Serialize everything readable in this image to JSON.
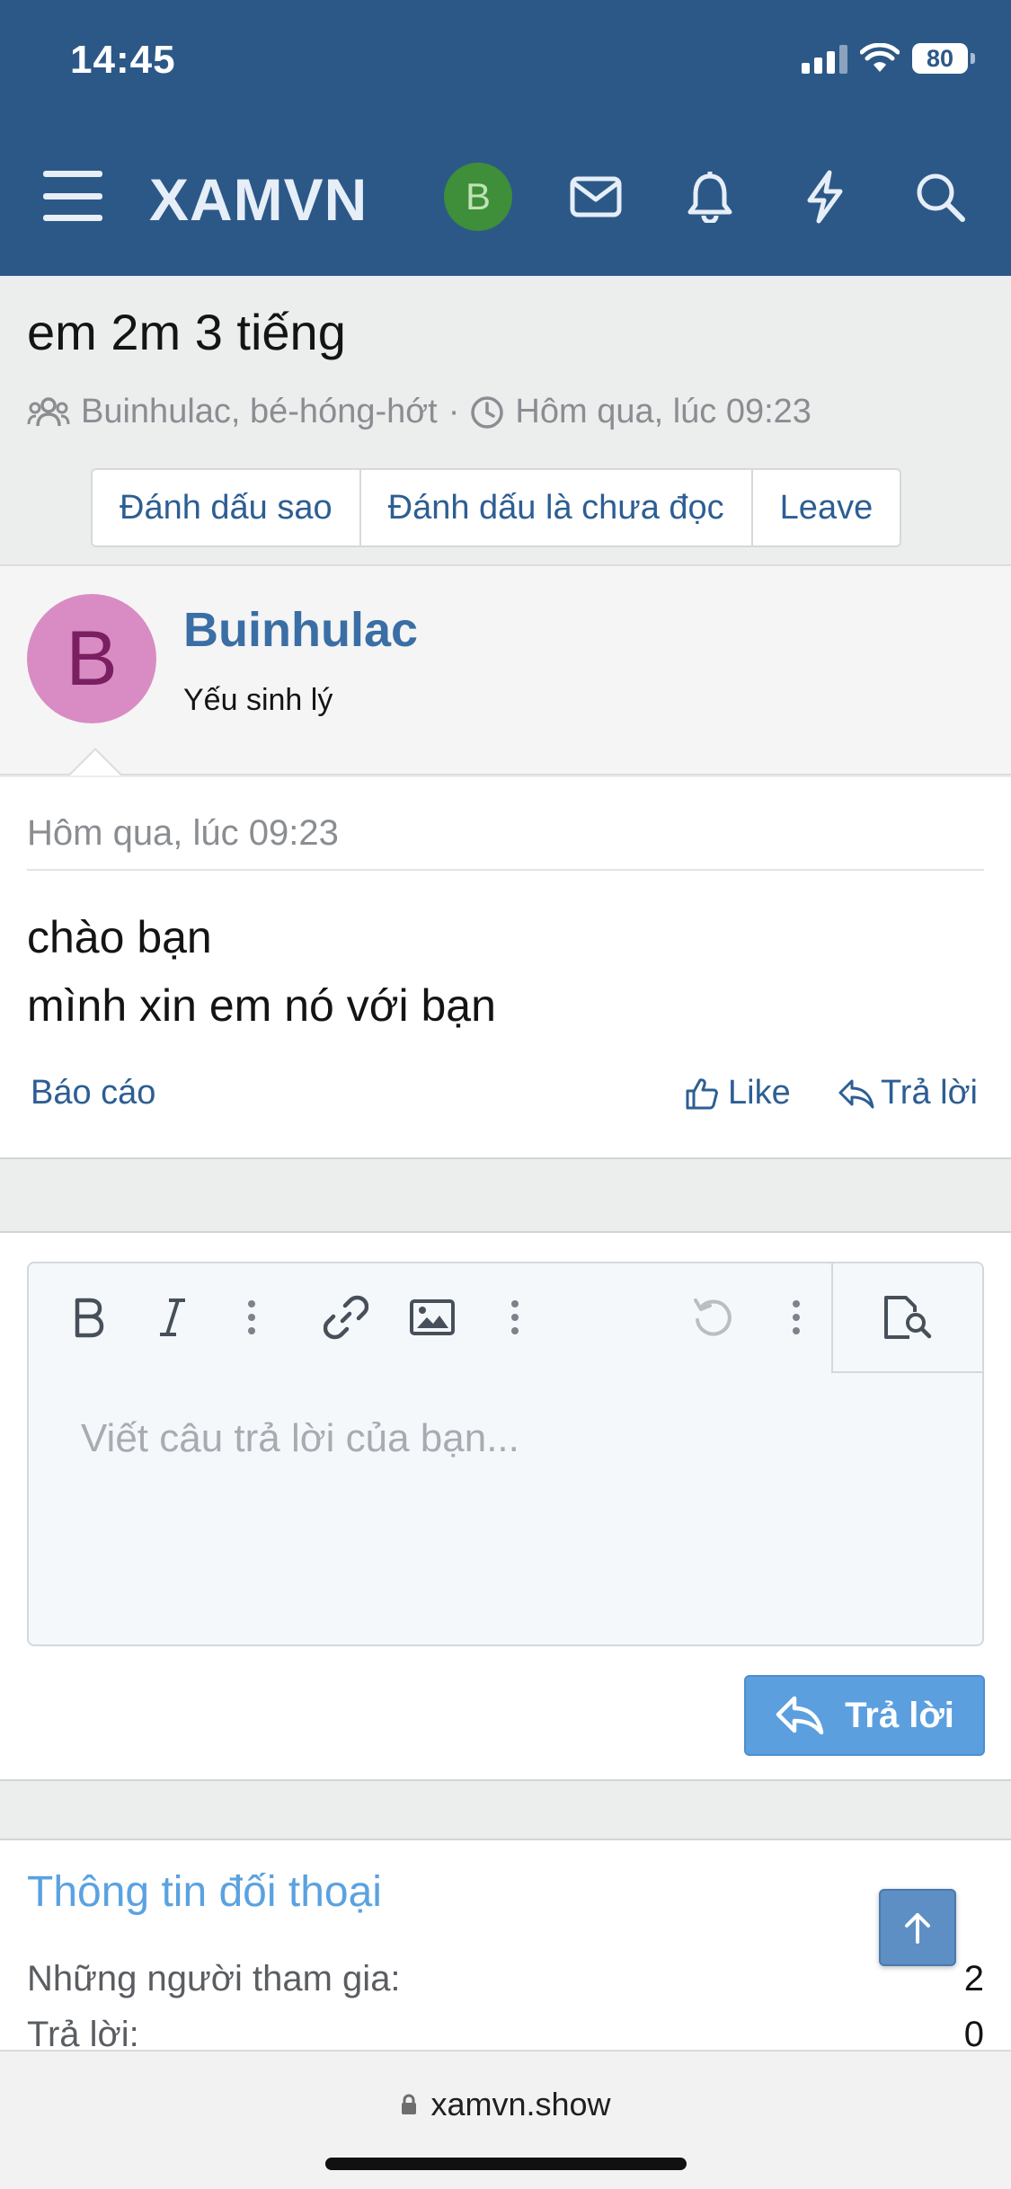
{
  "status_bar": {
    "time": "14:45",
    "battery": "80"
  },
  "header": {
    "brand": "XAMVN",
    "avatar_letter": "B"
  },
  "conversation": {
    "title": "em 2m 3 tiếng",
    "participants": "Buinhulac, bé-hóng-hớt",
    "separator": "·",
    "time": "Hôm qua, lúc 09:23",
    "buttons": [
      "Đánh dấu sao",
      "Đánh dấu là chưa đọc",
      "Leave"
    ]
  },
  "message": {
    "avatar_letter": "B",
    "username": "Buinhulac",
    "user_title": "Yếu sinh lý",
    "date": "Hôm qua, lúc 09:23",
    "lines": [
      "chào bạn",
      "mình xin em nó với bạn"
    ],
    "report_label": "Báo cáo",
    "like_label": "Like",
    "reply_label": "Trả lời"
  },
  "editor": {
    "placeholder": "Viết câu trả lời của bạn...",
    "submit_label": "Trả lời"
  },
  "info": {
    "title": "Thông tin đối thoại",
    "rows": [
      {
        "label": "Những người tham gia:",
        "value": "2"
      },
      {
        "label": "Trả lời:",
        "value": "0"
      }
    ]
  },
  "browser": {
    "url": "xamvn.show"
  },
  "colors": {
    "header_bg": "#2c5888",
    "link": "#2d5e93",
    "username": "#3a6ea5",
    "submit_bg": "#5b9fdf",
    "avatar_small_bg": "#3e8e3a",
    "avatar_big_bg": "#d98cc3"
  }
}
